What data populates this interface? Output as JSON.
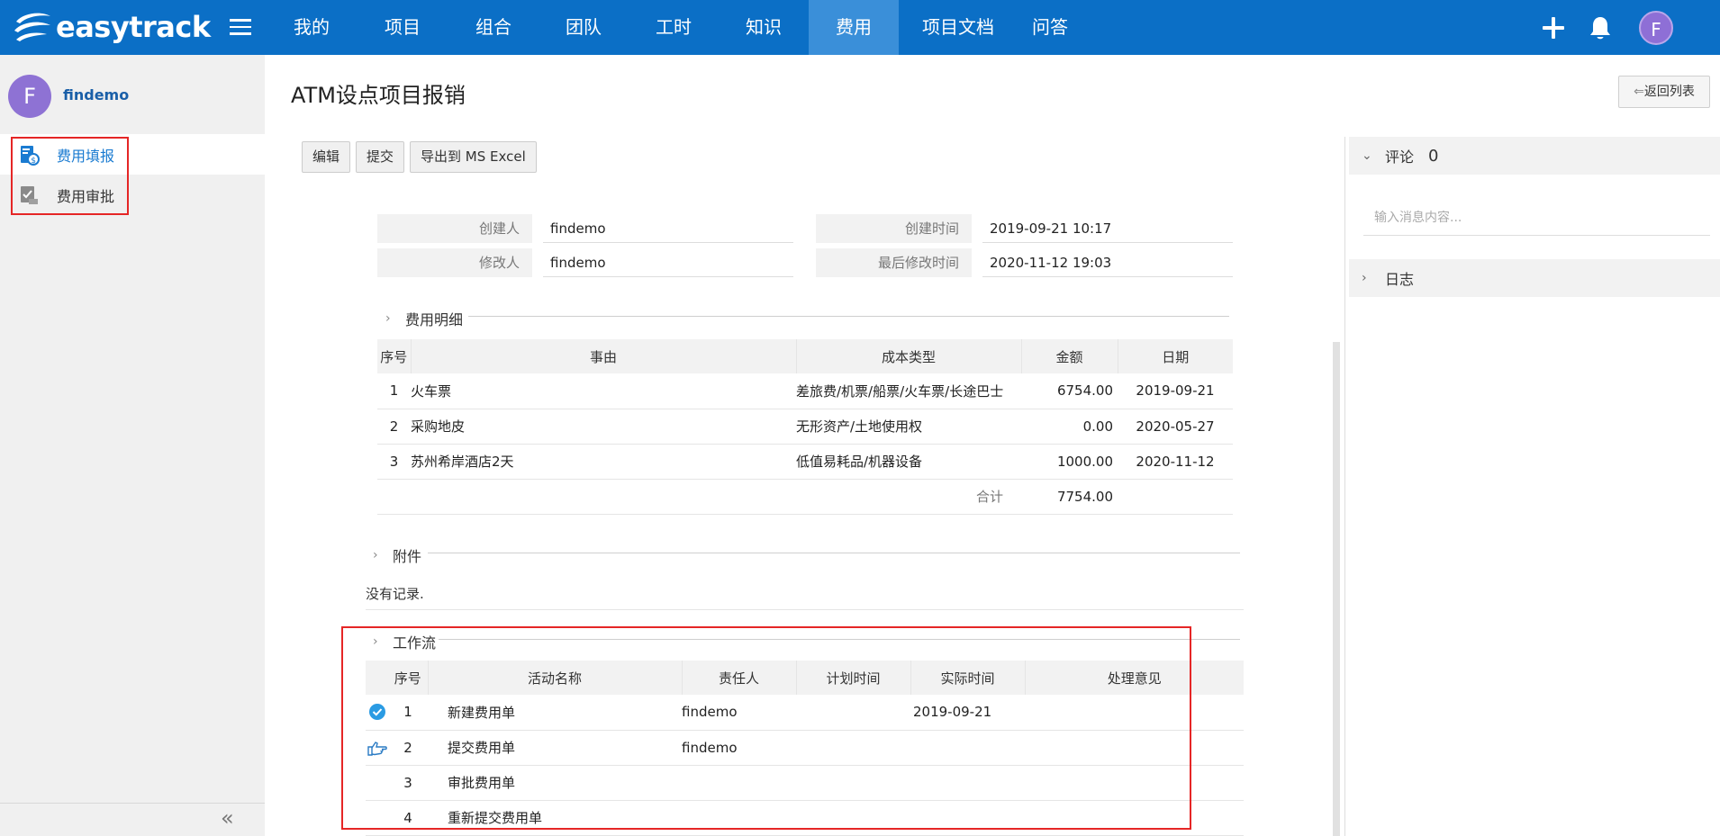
{
  "app": {
    "logo_text": "easytrack",
    "brand_color": "#0b6fc6"
  },
  "nav": {
    "items": [
      {
        "label": "我的"
      },
      {
        "label": "项目"
      },
      {
        "label": "组合"
      },
      {
        "label": "团队"
      },
      {
        "label": "工时"
      },
      {
        "label": "知识"
      },
      {
        "label": "费用",
        "active": true
      },
      {
        "label": "项目文档"
      },
      {
        "label": "问答"
      }
    ],
    "avatar_letter": "F"
  },
  "sidebar": {
    "avatar_letter": "F",
    "username": "findemo",
    "items": [
      {
        "label": "费用填报",
        "icon": "expense-fill-icon",
        "active": true
      },
      {
        "label": "费用审批",
        "icon": "expense-approve-icon"
      }
    ]
  },
  "page": {
    "title": "ATM设点项目报销",
    "back_label": "返回列表",
    "toolbar": {
      "edit": "编辑",
      "submit": "提交",
      "export": "导出到 MS Excel"
    }
  },
  "info": {
    "creator_label": "创建人",
    "creator": "findemo",
    "created_label": "创建时间",
    "created": "2019-09-21 10:17",
    "modifier_label": "修改人",
    "modifier": "findemo",
    "modified_label": "最后修改时间",
    "modified": "2020-11-12 19:03"
  },
  "expenses": {
    "section_title": "费用明细",
    "headers": [
      "序号",
      "事由",
      "成本类型",
      "金额",
      "日期"
    ],
    "rows": [
      [
        "1",
        "火车票",
        "差旅费/机票/船票/火车票/长途巴士",
        "6754.00",
        "2019-09-21"
      ],
      [
        "2",
        "采购地皮",
        "无形资产/土地使用权",
        "0.00",
        "2020-05-27"
      ],
      [
        "3",
        "苏州希岸酒店2天",
        "低值易耗品/机器设备",
        "1000.00",
        "2020-11-12"
      ]
    ],
    "total_label": "合计",
    "total": "7754.00"
  },
  "attachments": {
    "section_title": "附件",
    "empty_text": "没有记录."
  },
  "workflow": {
    "section_title": "工作流",
    "headers": [
      "序号",
      "活动名称",
      "责任人",
      "计划时间",
      "实际时间",
      "处理意见"
    ],
    "rows": [
      {
        "status_icon": "check-circle-icon",
        "no": "1",
        "name": "新建费用单",
        "owner": "findemo",
        "planned": "",
        "actual": "2019-09-21",
        "comment": ""
      },
      {
        "status_icon": "pointing-hand-icon",
        "no": "2",
        "name": "提交费用单",
        "owner": "findemo",
        "planned": "",
        "actual": "",
        "comment": ""
      },
      {
        "status_icon": "",
        "no": "3",
        "name": "审批费用单",
        "owner": "",
        "planned": "",
        "actual": "",
        "comment": ""
      },
      {
        "status_icon": "",
        "no": "4",
        "name": "重新提交费用单",
        "owner": "",
        "planned": "",
        "actual": "",
        "comment": ""
      }
    ]
  },
  "right_panel": {
    "comments_label": "评论",
    "comments_count": "0",
    "comment_placeholder": "输入消息内容...",
    "log_label": "日志"
  }
}
